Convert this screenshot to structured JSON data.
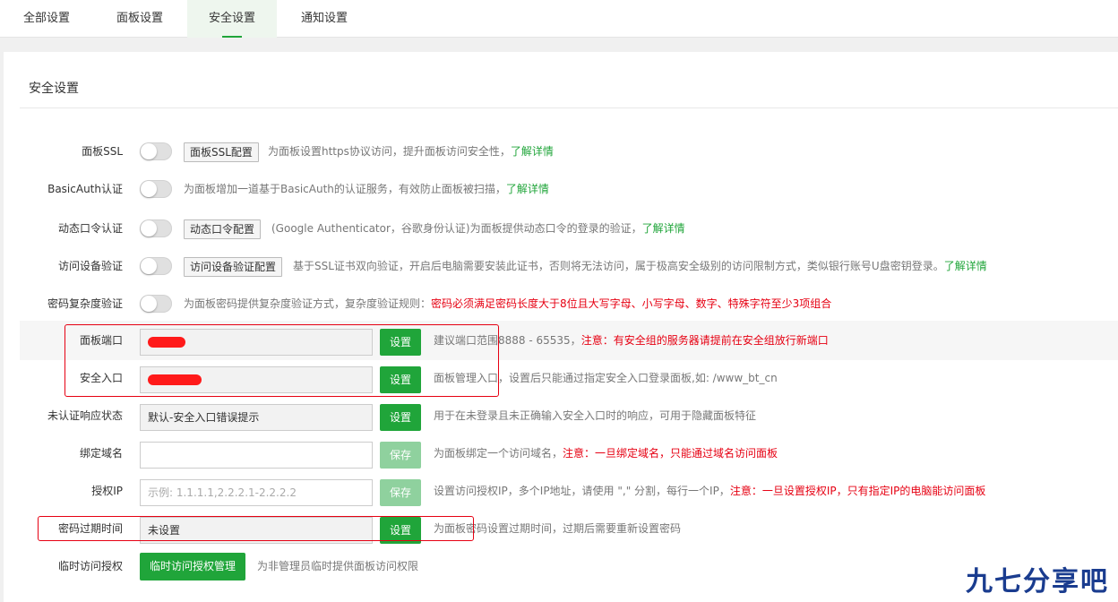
{
  "tabs": [
    {
      "label": "全部设置"
    },
    {
      "label": "面板设置"
    },
    {
      "label": "安全设置"
    },
    {
      "label": "通知设置"
    }
  ],
  "panel": {
    "title": "安全设置"
  },
  "rows": {
    "ssl": {
      "label": "面板SSL",
      "button": "面板SSL配置",
      "desc": "为面板设置https协议访问，提升面板访问安全性，",
      "link": "了解详情"
    },
    "basicauth": {
      "label": "BasicAuth认证",
      "desc": "为面板增加一道基于BasicAuth的认证服务，有效防止面板被扫描，",
      "link": "了解详情"
    },
    "totp": {
      "label": "动态口令认证",
      "button": "动态口令配置",
      "desc": "(Google Authenticator，谷歌身份认证)为面板提供动态口令的登录的验证，",
      "link": "了解详情"
    },
    "device": {
      "label": "访问设备验证",
      "button": "访问设备验证配置",
      "desc": "基于SSL证书双向验证，开启后电脑需要安装此证书，否则将无法访问，属于极高安全级别的访问限制方式，类似银行账号U盘密钥登录。",
      "link": "了解详情"
    },
    "complexity": {
      "label": "密码复杂度验证",
      "desc": "为面板密码提供复杂度验证方式，复杂度验证规则：",
      "warn": "密码必须满足密码长度大于8位且大写字母、小写字母、数字、特殊字符至少3项组合"
    },
    "port": {
      "label": "面板端口",
      "button": "设置",
      "desc": "建议端口范围8888 - 65535，",
      "warn": "注意：有安全组的服务器请提前在安全组放行新端口"
    },
    "entry": {
      "label": "安全入口",
      "button": "设置",
      "desc": "面板管理入口，设置后只能通过指定安全入口登录面板,如: /www_bt_cn"
    },
    "unauth": {
      "label": "未认证响应状态",
      "value": "默认-安全入口错误提示",
      "button": "设置",
      "desc": "用于在未登录且未正确输入安全入口时的响应，可用于隐藏面板特征"
    },
    "domain": {
      "label": "绑定域名",
      "value": "",
      "button": "保存",
      "desc": "为面板绑定一个访问域名，",
      "warn": "注意：一旦绑定域名，只能通过域名访问面板"
    },
    "ip": {
      "label": "授权IP",
      "placeholder": "示例: 1.1.1.1,2.2.2.1-2.2.2.2",
      "button": "保存",
      "desc": "设置访问授权IP，多个IP地址，请使用 \",\" 分割，每行一个IP，",
      "warn": "注意：一旦设置授权IP，只有指定IP的电脑能访问面板"
    },
    "expire": {
      "label": "密码过期时间",
      "value": "未设置",
      "button": "设置",
      "desc": "为面板密码设置过期时间，过期后需要重新设置密码"
    },
    "temp": {
      "label": "临时访问授权",
      "button": "临时访问授权管理",
      "desc": "为非管理员临时提供面板访问权限"
    }
  },
  "watermark": "九七分享吧",
  "colors": {
    "accent": "#20a53a",
    "warn": "#e60012",
    "highlight_box": "#e60012"
  }
}
